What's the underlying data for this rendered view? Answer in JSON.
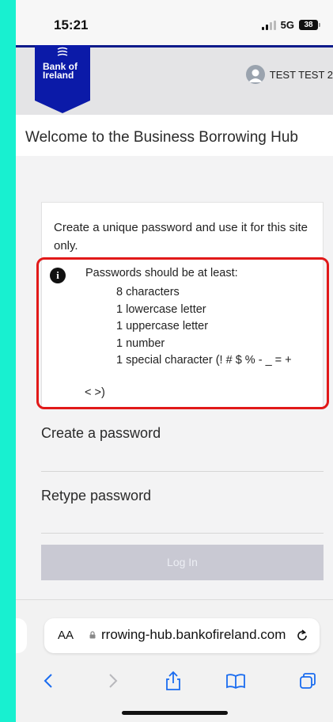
{
  "status_bar": {
    "time": "15:21",
    "network": "5G",
    "battery": "38"
  },
  "header": {
    "logo_text_line1": "Bank of",
    "logo_text_line2": "Ireland",
    "user_name": "TEST TEST 2",
    "brand_color": "#0b1aa8"
  },
  "welcome": {
    "title": "Welcome to the Business Borrowing Hub"
  },
  "password_card": {
    "intro": "Create a unique password and use it for this site only.",
    "rules_heading": "Passwords should be at least:",
    "rules": [
      "8 characters",
      "1 lowercase letter",
      "1 uppercase letter",
      "1 number",
      "1 special character (! # $ % - _ = +"
    ],
    "rules_tail": "< >)",
    "highlight_color": "#e11919"
  },
  "form": {
    "create_label": "Create a password",
    "retype_label": "Retype password",
    "login_label": "Log In"
  },
  "browser": {
    "text_size_label": "AA",
    "url": "rrowing-hub.bankofireland.com",
    "icons": [
      "lock-icon",
      "reload-icon",
      "back-icon",
      "forward-icon",
      "share-icon",
      "bookmarks-icon",
      "tabs-icon"
    ]
  }
}
